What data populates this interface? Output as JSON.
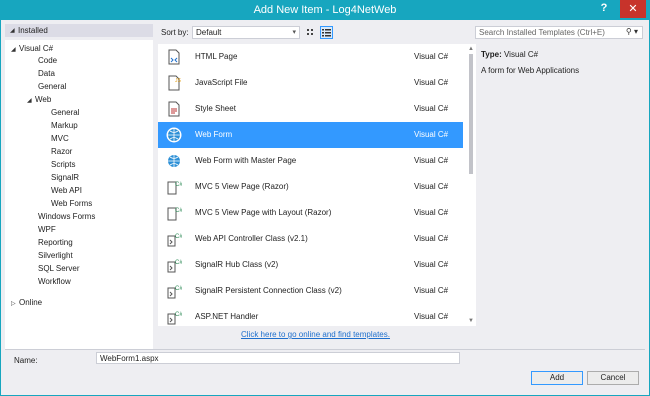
{
  "window": {
    "title": "Add New Item - Log4NetWeb",
    "help_glyph": "?",
    "close_glyph": "✕"
  },
  "tree": {
    "header": "Installed",
    "nodes": [
      {
        "label": "Visual C#",
        "toggle": "◢"
      },
      {
        "label": "Code"
      },
      {
        "label": "Data"
      },
      {
        "label": "General"
      },
      {
        "label": "Web",
        "toggle": "◢"
      },
      {
        "label": "General"
      },
      {
        "label": "Markup"
      },
      {
        "label": "MVC"
      },
      {
        "label": "Razor"
      },
      {
        "label": "Scripts"
      },
      {
        "label": "SignalR"
      },
      {
        "label": "Web API"
      },
      {
        "label": "Web Forms"
      },
      {
        "label": "Windows Forms"
      },
      {
        "label": "WPF"
      },
      {
        "label": "Reporting"
      },
      {
        "label": "Silverlight"
      },
      {
        "label": "SQL Server"
      },
      {
        "label": "Workflow"
      }
    ],
    "online": {
      "label": "Online",
      "toggle": "▷"
    }
  },
  "toolbar": {
    "sort_label": "Sort by:",
    "sort_value": "Default"
  },
  "search": {
    "placeholder": "Search Installed Templates (Ctrl+E)"
  },
  "templates": [
    {
      "name": "HTML Page",
      "lang": "Visual C#",
      "icon": "html-page-icon"
    },
    {
      "name": "JavaScript File",
      "lang": "Visual C#",
      "icon": "javascript-file-icon"
    },
    {
      "name": "Style Sheet",
      "lang": "Visual C#",
      "icon": "style-sheet-icon"
    },
    {
      "name": "Web Form",
      "lang": "Visual C#",
      "icon": "web-form-icon",
      "selected": true
    },
    {
      "name": "Web Form with Master Page",
      "lang": "Visual C#",
      "icon": "web-form-icon"
    },
    {
      "name": "MVC 5 View Page (Razor)",
      "lang": "Visual C#",
      "icon": "razor-page-icon"
    },
    {
      "name": "MVC 5 View Page with Layout (Razor)",
      "lang": "Visual C#",
      "icon": "razor-page-icon"
    },
    {
      "name": "Web API Controller Class (v2.1)",
      "lang": "Visual C#",
      "icon": "csharp-class-icon"
    },
    {
      "name": "SignalR Hub Class (v2)",
      "lang": "Visual C#",
      "icon": "csharp-class-icon"
    },
    {
      "name": "SignalR Persistent Connection Class (v2)",
      "lang": "Visual C#",
      "icon": "csharp-class-icon"
    },
    {
      "name": "ASP.NET Handler",
      "lang": "Visual C#",
      "icon": "csharp-class-icon"
    }
  ],
  "online_link": "Click here to go online and find templates.",
  "details": {
    "type_label": "Type:",
    "type_value": "Visual C#",
    "description": "A form for Web Applications"
  },
  "name_field": {
    "label": "Name:",
    "value": "WebForm1.aspx"
  },
  "buttons": {
    "add": "Add",
    "cancel": "Cancel"
  },
  "colors": {
    "accent": "#17a6bf",
    "selection": "#3399ff",
    "close": "#c7332b",
    "link": "#1e6fcd"
  }
}
